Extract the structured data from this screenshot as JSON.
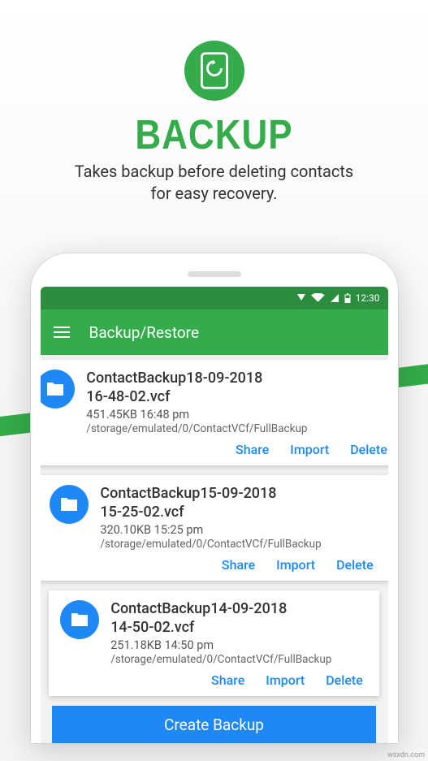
{
  "hero": {
    "title": "BACKUP",
    "subtitle_l1": "Takes backup before deleting contacts",
    "subtitle_l2": "for easy recovery."
  },
  "statusbar": {
    "time": "12:30"
  },
  "appbar": {
    "title": "Backup/Restore"
  },
  "actions": {
    "share": "Share",
    "import": "Import",
    "delete": "Delete"
  },
  "backups": [
    {
      "name_l1": "ContactBackup18-09-2018",
      "name_l2": "16-48-02.vcf",
      "size_time": "451.45KB   16:48 pm",
      "path": "/storage/emulated/0/ContactVCf/FullBackup"
    },
    {
      "name_l1": "ContactBackup15-09-2018",
      "name_l2": "15-25-02.vcf",
      "size_time": "320.10KB   15:25 pm",
      "path": "/storage/emulated/0/ContactVCf/FullBackup"
    },
    {
      "name_l1": "ContactBackup14-09-2018",
      "name_l2": "14-50-02.vcf",
      "size_time": "251.18KB   14:50 pm",
      "path": "/storage/emulated/0/ContactVCf/FullBackup"
    }
  ],
  "create_button": "Create Backup",
  "watermark": "wsxdn.com"
}
